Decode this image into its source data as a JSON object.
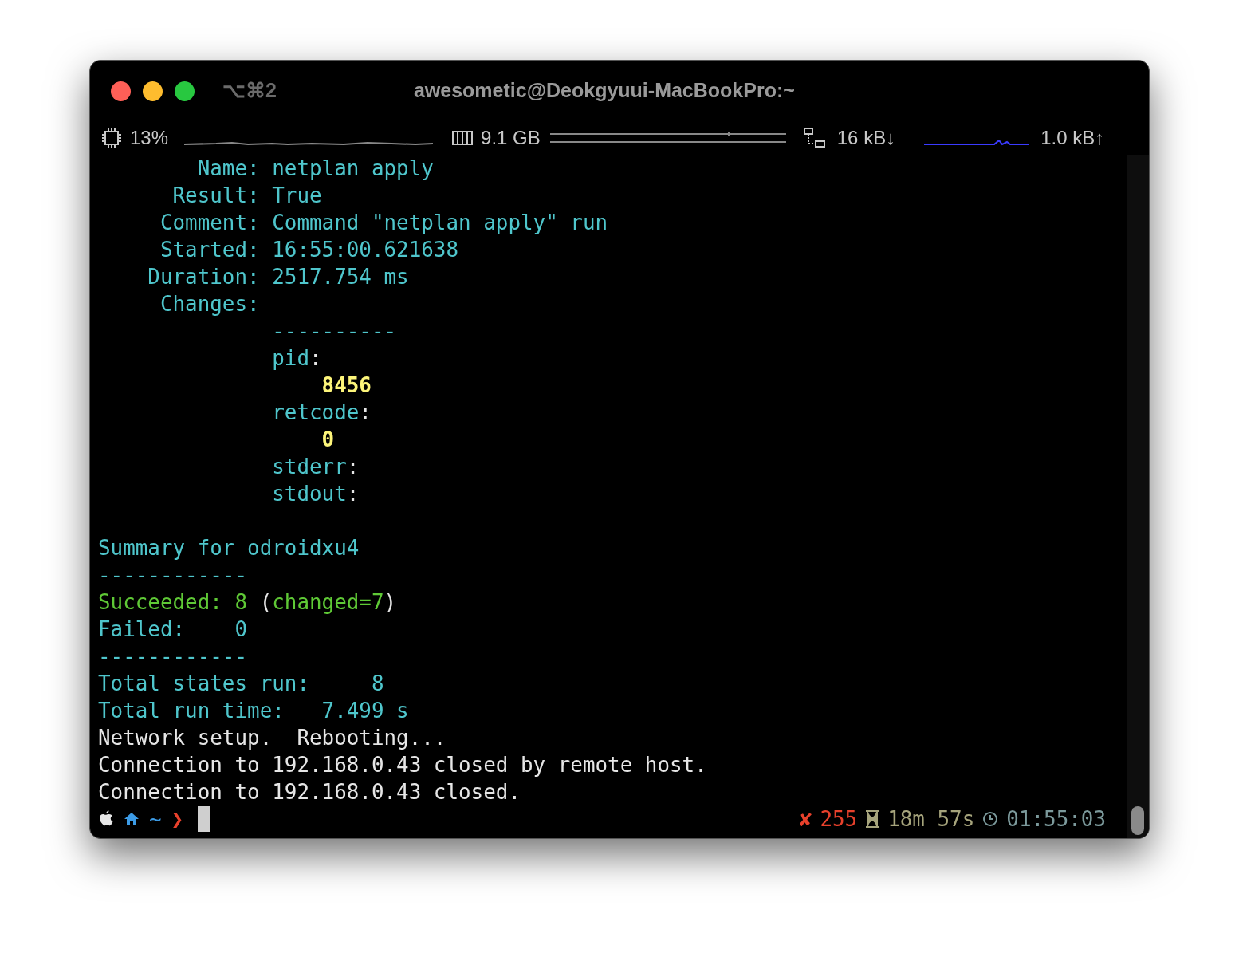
{
  "window": {
    "shortcut": "⌥⌘2",
    "title": "awesometic@Deokgyuui-MacBookPro:~"
  },
  "status_bar": {
    "cpu": "13%",
    "memory": "9.1 GB",
    "download": "16 kB↓",
    "upload": "1.0 kB↑"
  },
  "lines": [
    {
      "kind": "text",
      "segments": [
        {
          "text": "        Name: netplan apply",
          "color": "#4fc6cc"
        }
      ]
    },
    {
      "kind": "text",
      "segments": [
        {
          "text": "      Result: True",
          "color": "#4fc6cc"
        }
      ]
    },
    {
      "kind": "text",
      "segments": [
        {
          "text": "     Comment: Command \"netplan apply\" run",
          "color": "#4fc6cc"
        }
      ]
    },
    {
      "kind": "text",
      "segments": [
        {
          "text": "     Started: 16:55:00.621638",
          "color": "#4fc6cc"
        }
      ]
    },
    {
      "kind": "text",
      "segments": [
        {
          "text": "    Duration: 2517.754 ms",
          "color": "#4fc6cc"
        }
      ]
    },
    {
      "kind": "text",
      "segments": [
        {
          "text": "     Changes:",
          "color": "#4fc6cc"
        }
      ]
    },
    {
      "kind": "text",
      "segments": [
        {
          "text": "              ----------",
          "color": "#4fc6cc"
        }
      ]
    },
    {
      "kind": "text",
      "segments": [
        {
          "text": "              pid",
          "color": "#4fc6cc"
        },
        {
          "text": ":",
          "color": "#e6e6e6"
        }
      ]
    },
    {
      "kind": "text",
      "segments": [
        {
          "text": "                  8456",
          "color": "#fdf57a"
        }
      ]
    },
    {
      "kind": "text",
      "segments": [
        {
          "text": "              retcode",
          "color": "#4fc6cc"
        },
        {
          "text": ":",
          "color": "#e6e6e6"
        }
      ]
    },
    {
      "kind": "text",
      "segments": [
        {
          "text": "                  0",
          "color": "#fdf57a"
        }
      ]
    },
    {
      "kind": "text",
      "segments": [
        {
          "text": "              stderr",
          "color": "#4fc6cc"
        },
        {
          "text": ":",
          "color": "#e6e6e6"
        }
      ]
    },
    {
      "kind": "text",
      "segments": [
        {
          "text": "              stdout",
          "color": "#4fc6cc"
        },
        {
          "text": ":",
          "color": "#e6e6e6"
        }
      ]
    },
    {
      "kind": "blank"
    },
    {
      "kind": "text",
      "segments": [
        {
          "text": "Summary for odroidxu4",
          "color": "#4fc6cc"
        }
      ]
    },
    {
      "kind": "text",
      "segments": [
        {
          "text": "------------",
          "color": "#4fc6cc"
        }
      ]
    },
    {
      "kind": "text",
      "segments": [
        {
          "text": "Succeeded: 8",
          "color": "#5fc936"
        },
        {
          "text": " (",
          "color": "#e6e6e6"
        },
        {
          "text": "changed=7",
          "color": "#5fc936"
        },
        {
          "text": ")",
          "color": "#e6e6e6"
        }
      ]
    },
    {
      "kind": "text",
      "segments": [
        {
          "text": "Failed:    0",
          "color": "#4fc6cc"
        }
      ]
    },
    {
      "kind": "text",
      "segments": [
        {
          "text": "------------",
          "color": "#4fc6cc"
        }
      ]
    },
    {
      "kind": "text",
      "segments": [
        {
          "text": "Total states run:     8",
          "color": "#4fc6cc"
        }
      ]
    },
    {
      "kind": "text",
      "segments": [
        {
          "text": "Total run time:   7.499 s",
          "color": "#4fc6cc"
        }
      ]
    },
    {
      "kind": "text",
      "segments": [
        {
          "text": "Network setup.  Rebooting...",
          "color": "#e6e6e6"
        }
      ]
    },
    {
      "kind": "text",
      "segments": [
        {
          "text": "Connection to 192.168.0.43 closed by remote host.",
          "color": "#e6e6e6"
        }
      ]
    },
    {
      "kind": "text",
      "segments": [
        {
          "text": "Connection to 192.168.0.43 closed.",
          "color": "#e6e6e6"
        }
      ]
    }
  ],
  "prompt": {
    "directory": "~",
    "chevron": "❯",
    "error_mark": "✘",
    "exit_code": "255",
    "elapsed": "18m 57s",
    "time": "01:55:03"
  }
}
